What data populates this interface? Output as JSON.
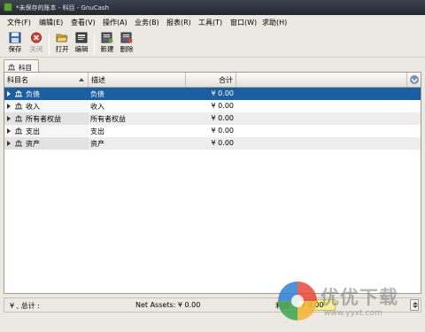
{
  "window": {
    "title": "*未保存的账本 - 科目 - GnuCash"
  },
  "menu": {
    "items": [
      {
        "label": "文件(F)"
      },
      {
        "label": "编辑(E)"
      },
      {
        "label": "查看(V)"
      },
      {
        "label": "操作(A)"
      },
      {
        "label": "业务(B)"
      },
      {
        "label": "报表(R)"
      },
      {
        "label": "工具(T)"
      },
      {
        "label": "窗口(W)"
      },
      {
        "label": "求助(H)"
      }
    ]
  },
  "toolbar": {
    "save_label": "保存",
    "close_label": "关闭",
    "open_label": "打开",
    "edit_label": "编辑",
    "new_label": "新建",
    "delete_label": "删除"
  },
  "tab": {
    "label": "科目"
  },
  "table": {
    "columns": {
      "name": "科目名",
      "description": "描述",
      "total": "合计"
    },
    "rows": [
      {
        "name": "负债",
        "description": "负债",
        "total": "¥ 0.00",
        "selected": true
      },
      {
        "name": "收入",
        "description": "收入",
        "total": "¥ 0.00"
      },
      {
        "name": "所有者权益",
        "description": "所有者权益",
        "total": "¥ 0.00"
      },
      {
        "name": "支出",
        "description": "支出",
        "total": "¥ 0.00"
      },
      {
        "name": "资产",
        "description": "资产",
        "total": "¥ 0.00"
      }
    ]
  },
  "summary": {
    "currency_label": "¥ , 总计 :",
    "net_assets": "Net Assets: ¥ 0.00",
    "profit_label": "利润 :",
    "profit_value": "¥ 0.00"
  },
  "watermark": {
    "text": "优优下载",
    "url": "www.yyxt.com"
  },
  "colors": {
    "selection": "#1b5fa3",
    "profit_highlight": "#f7ed9a"
  }
}
